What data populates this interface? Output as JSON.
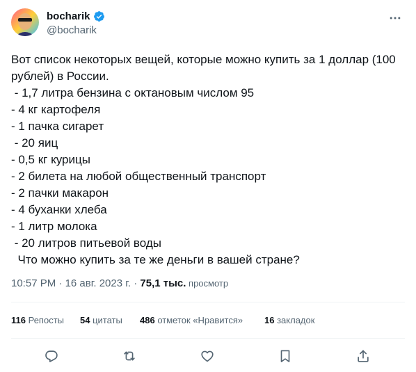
{
  "author": {
    "display_name": "bocharik",
    "handle": "@bocharik",
    "verified_icon": "verified-badge-icon",
    "avatar_icon": "avatar-portrait",
    "badge_color": "#1d9bf0"
  },
  "more_icon": "more-horizontal-icon",
  "tweet": {
    "lines": [
      "Вот список некоторых вещей, которые можно купить за 1 доллар (100",
      "рублей) в России.",
      " - 1,7 литра бензина с октановым числом 95",
      "- 4 кг картофеля",
      "- 1 пачка сигарет",
      " - 20 яиц",
      "- 0,5 кг курицы",
      "- 2 билета на любой общественный транспорт",
      "- 2 пачки макарон",
      "- 4 буханки хлеба",
      "- 1 литр молока",
      " - 20 литров питьевой воды",
      "  Что можно купить за те же деньги в вашей стране?"
    ]
  },
  "meta": {
    "time": "10:57 PM",
    "separator1": " · ",
    "date": "16 авг. 2023 г.",
    "separator2": " · ",
    "views_count": "75,1 тыс.",
    "views_label": " просмотр"
  },
  "stats": {
    "reposts": {
      "num": "116",
      "label": " Репосты"
    },
    "quotes": {
      "num": "54",
      "label": " цитаты"
    },
    "likes": {
      "num": "486",
      "label": " отметок «Нравится»"
    },
    "bookmarks": {
      "num": "16",
      "label": " закладок"
    }
  },
  "actions": [
    "reply-icon",
    "repost-icon",
    "like-icon",
    "bookmark-icon",
    "share-icon"
  ],
  "colors": {
    "text": "#0f1419",
    "secondary": "#536471",
    "divider": "#eff3f4"
  }
}
